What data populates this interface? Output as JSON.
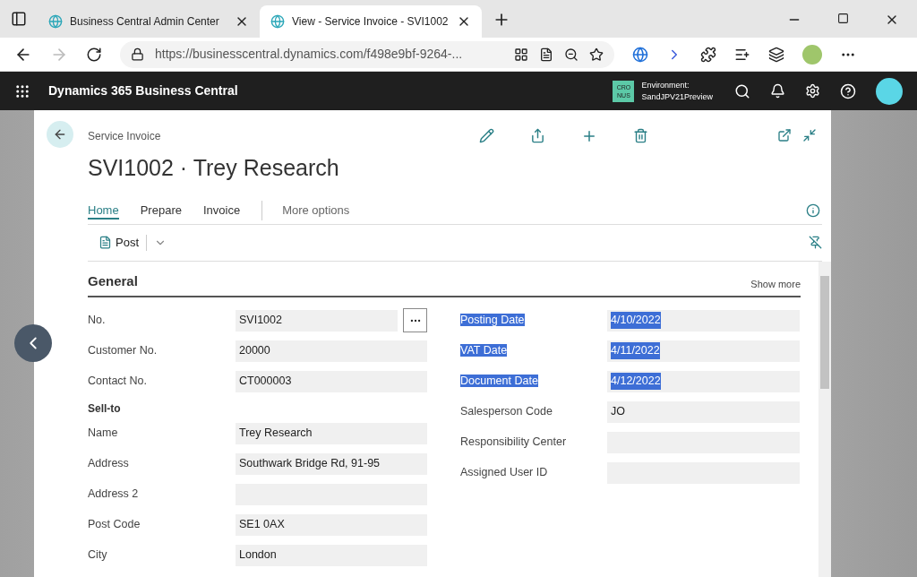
{
  "browser": {
    "tabs": [
      {
        "title": "Business Central Admin Center",
        "selected": false
      },
      {
        "title": "View - Service Invoice - SVI1002",
        "selected": true
      }
    ],
    "url": "https://businesscentral.dynamics.com/f498e9bf-9264-..."
  },
  "app": {
    "title": "Dynamics 365 Business Central",
    "company_badge": [
      "CRO",
      "NUS"
    ],
    "environment_label": "Environment:",
    "environment": "SandJPV21Preview"
  },
  "page": {
    "caption": "Service Invoice",
    "title": "SVI1002 · Trey Research",
    "tabs": [
      {
        "label": "Home",
        "selected": true
      },
      {
        "label": "Prepare",
        "selected": false
      },
      {
        "label": "Invoice",
        "selected": false
      }
    ],
    "more_options": "More options",
    "actions": [
      {
        "label": "Post"
      }
    ],
    "section": {
      "title": "General",
      "show_more": "Show more"
    },
    "left_fields": [
      {
        "kind": "field",
        "label": "No.",
        "value": "SVI1002",
        "lookup": true
      },
      {
        "kind": "field",
        "label": "Customer No.",
        "value": "20000",
        "lookup": false
      },
      {
        "kind": "field",
        "label": "Contact No.",
        "value": "CT000003",
        "lookup": false
      },
      {
        "kind": "group",
        "label": "Sell-to"
      },
      {
        "kind": "field",
        "label": "Name",
        "value": "Trey Research",
        "lookup": false
      },
      {
        "kind": "field",
        "label": "Address",
        "value": "Southwark Bridge Rd, 91-95",
        "lookup": false
      },
      {
        "kind": "field",
        "label": "Address 2",
        "lookup": false
      },
      {
        "kind": "field",
        "label": "Post Code",
        "value": "SE1 0AX",
        "lookup": false
      },
      {
        "kind": "field",
        "label": "City",
        "value": "London",
        "lookup": false
      }
    ],
    "right_fields": [
      {
        "label": "Posting Date",
        "value": "4/10/2022",
        "highlighted": true
      },
      {
        "label": "VAT Date",
        "value": "4/11/2022",
        "highlighted": true
      },
      {
        "label": "Document Date",
        "value": "4/12/2022",
        "highlighted": true
      },
      {
        "label": "Salesperson Code",
        "value": "JO",
        "highlighted": false
      },
      {
        "label": "Responsibility Center",
        "highlighted": false
      },
      {
        "label": "Assigned User ID",
        "highlighted": false
      }
    ]
  }
}
